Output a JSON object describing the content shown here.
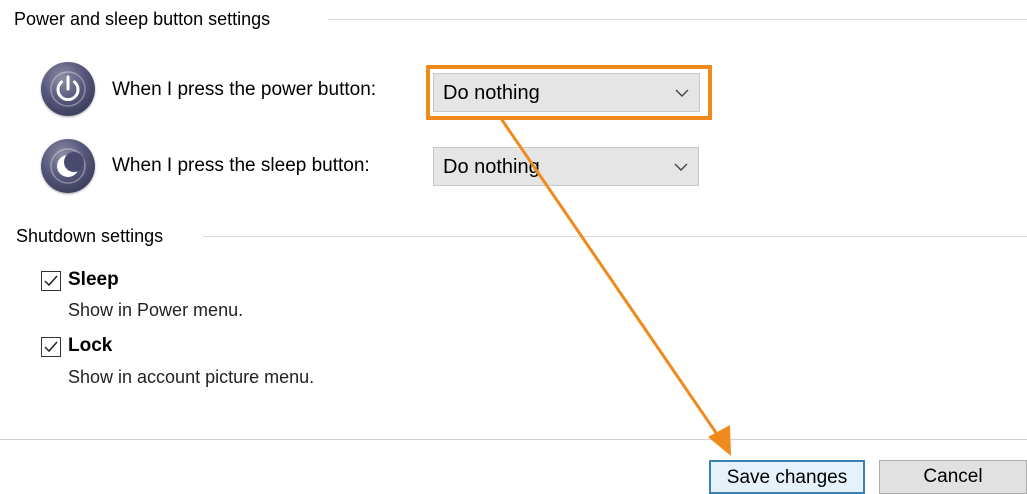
{
  "power_sleep_group": {
    "title": "Power and sleep button settings",
    "power_row": {
      "icon": "power-icon",
      "label": "When I press the power button:",
      "selected": "Do nothing"
    },
    "sleep_row": {
      "icon": "sleep-moon-icon",
      "label": "When I press the sleep button:",
      "selected": "Do nothing"
    }
  },
  "shutdown_group": {
    "title": "Shutdown settings",
    "items": [
      {
        "label": "Sleep",
        "description": "Show in Power menu.",
        "checked": true
      },
      {
        "label": "Lock",
        "description": "Show in account picture menu.",
        "checked": true
      }
    ]
  },
  "footer": {
    "save_label": "Save changes",
    "cancel_label": "Cancel"
  },
  "annotation": {
    "color": "#f08a1c"
  },
  "colors": {
    "combo_background": "#e5e5e5",
    "default_button_border": "#3c7fb1"
  }
}
